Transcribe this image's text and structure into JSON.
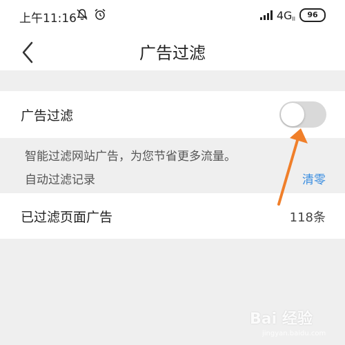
{
  "status_bar": {
    "time": "上午11:16",
    "network": "4G",
    "network_sub": "Il",
    "battery": "96",
    "icons": [
      "bell-off-icon",
      "alarm-icon",
      "signal-icon"
    ]
  },
  "nav": {
    "back_icon": "chevron-left-icon",
    "title": "广告过滤"
  },
  "setting": {
    "label": "广告过滤",
    "toggle_state": "off"
  },
  "info": {
    "description": "智能过滤网站广告，为您节省更多流量。",
    "record_label": "自动过滤记录",
    "clear_label": "清零"
  },
  "filtered": {
    "label": "已过滤页面广告",
    "count": "118条"
  },
  "annotation": {
    "color": "#f07f2a"
  },
  "watermark": {
    "text": "Bai 经验",
    "sub": "jingyan.baidu.com"
  }
}
